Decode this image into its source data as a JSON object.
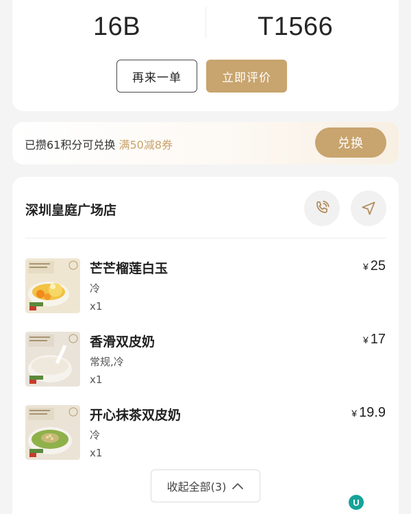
{
  "order": {
    "seat_number": "16B",
    "order_code": "T1566"
  },
  "actions": {
    "reorder_label": "再来一单",
    "rate_label": "立即评价"
  },
  "points_banner": {
    "text": "已攒61积分可兑换 ",
    "highlight": "满50减8券",
    "exchange_label": "兑换"
  },
  "store": {
    "name": "深圳皇庭广场店",
    "phone_icon": "phone-icon",
    "navigate_icon": "navigation-arrow-icon"
  },
  "items": [
    {
      "name": "芒芒榴莲白玉",
      "spec": "冷",
      "qty": "x1",
      "currency": "¥",
      "price": "25"
    },
    {
      "name": "香滑双皮奶",
      "spec": "常规,冷",
      "qty": "x1",
      "currency": "¥",
      "price": "17"
    },
    {
      "name": "开心抹茶双皮奶",
      "spec": "冷",
      "qty": "x1",
      "currency": "¥",
      "price": "19.9"
    }
  ],
  "collapse": {
    "label": "收起全部(3)"
  },
  "colors": {
    "accent": "#c8a46e",
    "accent_text": "#c9a46c",
    "background": "#f4f4f4"
  }
}
